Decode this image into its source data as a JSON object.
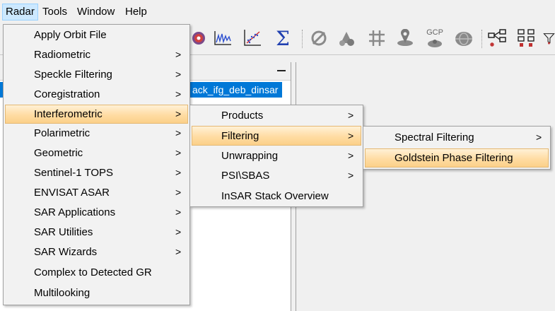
{
  "menubar": {
    "items": [
      {
        "label": "Radar"
      },
      {
        "label": "Tools"
      },
      {
        "label": "Window"
      },
      {
        "label": "Help"
      }
    ]
  },
  "toolbar": {
    "icons": [
      "globe-icon",
      "spectrum-icon",
      "scatter-plot-icon",
      "sigma-icon",
      "orbit-icon",
      "rocket-icon",
      "grid-icon",
      "gcp-pin-icon",
      "gcp-icon",
      "globe-eye-icon",
      "graph-builder-icon",
      "batch-processing-icon",
      "filter-icon"
    ],
    "gcp_text": "GCP",
    "sigma_text": "Σ"
  },
  "product_tree": {
    "selected_item": "ack_ifg_deb_dinsar"
  },
  "arrow": ">",
  "radar_menu": {
    "items": [
      {
        "label": "Apply Orbit File",
        "submenu": false
      },
      {
        "label": "Radiometric",
        "submenu": true
      },
      {
        "label": "Speckle Filtering",
        "submenu": true
      },
      {
        "label": "Coregistration",
        "submenu": true
      },
      {
        "label": "Interferometric",
        "submenu": true
      },
      {
        "label": "Polarimetric",
        "submenu": true
      },
      {
        "label": "Geometric",
        "submenu": true
      },
      {
        "label": "Sentinel-1 TOPS",
        "submenu": true
      },
      {
        "label": "ENVISAT ASAR",
        "submenu": true
      },
      {
        "label": "SAR Applications",
        "submenu": true
      },
      {
        "label": "SAR Utilities",
        "submenu": true
      },
      {
        "label": "SAR Wizards",
        "submenu": true
      },
      {
        "label": "Complex to Detected GR",
        "submenu": false
      },
      {
        "label": "Multilooking",
        "submenu": false
      }
    ]
  },
  "interferometric_menu": {
    "items": [
      {
        "label": "Products",
        "submenu": true
      },
      {
        "label": "Filtering",
        "submenu": true
      },
      {
        "label": "Unwrapping",
        "submenu": true
      },
      {
        "label": "PSI\\SBAS",
        "submenu": true
      },
      {
        "label": "InSAR Stack Overview",
        "submenu": false
      }
    ]
  },
  "filtering_menu": {
    "items": [
      {
        "label": "Spectral Filtering",
        "submenu": true
      },
      {
        "label": "Goldstein Phase Filtering",
        "submenu": false
      }
    ]
  }
}
